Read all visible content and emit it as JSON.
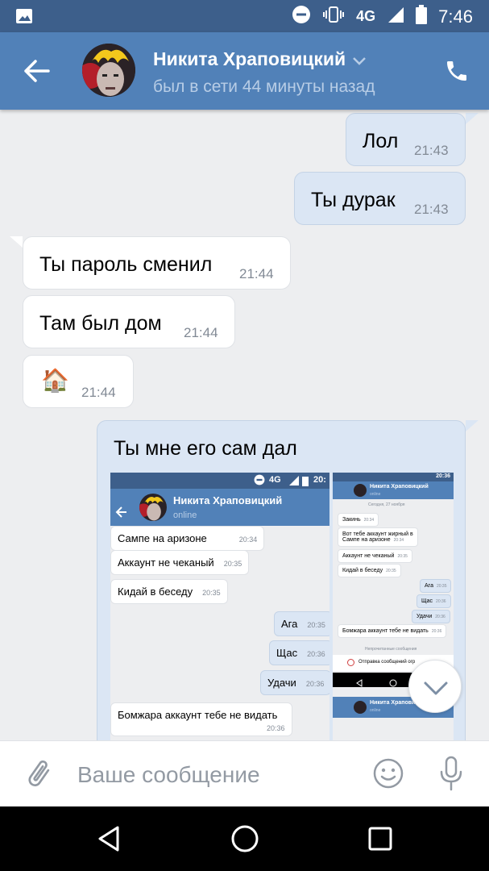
{
  "status_bar": {
    "time": "7:46",
    "network": "4G",
    "icons": [
      "image-icon",
      "do-not-disturb-icon",
      "vibrate-icon",
      "signal-icon",
      "battery-icon"
    ]
  },
  "header": {
    "name": "Никита Храповицкий",
    "status": "был в сети 44 минуты назад",
    "accent": "#5181b8"
  },
  "messages": [
    {
      "dir": "out",
      "text": "Лол",
      "time": "21:43"
    },
    {
      "dir": "out",
      "text": "Ты дурак",
      "time": "21:43"
    },
    {
      "dir": "in",
      "text": "Ты пароль сменил",
      "time": "21:44"
    },
    {
      "dir": "in",
      "text": "Там был дом",
      "time": "21:44"
    },
    {
      "dir": "in",
      "text": "🏠",
      "time": "21:44"
    },
    {
      "dir": "out",
      "text": "Ты мне его сам дал",
      "time": ""
    }
  ],
  "embedded_screenshot": {
    "status_time": "20:",
    "network": "4G",
    "name": "Никита Храповицкий",
    "status": "online",
    "messages": [
      {
        "dir": "in",
        "text": "Сампе на аризоне",
        "time": "20:34"
      },
      {
        "dir": "in",
        "text": "Аккаунт не чеканый",
        "time": "20:35"
      },
      {
        "dir": "in",
        "text": "Кидай в беседу",
        "time": "20:35"
      },
      {
        "dir": "out",
        "text": "Ага",
        "time": "20:35"
      },
      {
        "dir": "out",
        "text": "Щас",
        "time": "20:36"
      },
      {
        "dir": "out",
        "text": "Удачи",
        "time": "20:36"
      },
      {
        "dir": "in",
        "text": "Бомжара аккаунт тебе не видать",
        "time": "20:36"
      }
    ]
  },
  "embedded_screenshot_2": {
    "status_time": "20:36",
    "name": "Никита Храповицкий",
    "status": "online",
    "date": "Сегодня, 27 ноября",
    "messages": [
      {
        "dir": "in",
        "text": "Закинь",
        "time": "20:34"
      },
      {
        "dir": "in",
        "text": "Вот тебе аккаунт жирный в\nСампе на аризоне",
        "time": "20:34"
      },
      {
        "dir": "in",
        "text": "Аккаунт не чеканый",
        "time": "20:35"
      },
      {
        "dir": "in",
        "text": "Кидай в беседу",
        "time": "20:35"
      },
      {
        "dir": "out",
        "text": "Ага",
        "time": "20:35"
      },
      {
        "dir": "out",
        "text": "Щас",
        "time": "20:36"
      },
      {
        "dir": "out",
        "text": "Удачи",
        "time": "20:36"
      },
      {
        "dir": "in",
        "text": "Бомжара аккаунт тебе не видать",
        "time": "20:36"
      }
    ],
    "unread_label": "Непрочитанные сообщения",
    "error_text": "Отправка сообщений огр"
  },
  "input": {
    "placeholder": "Ваше сообщение"
  }
}
